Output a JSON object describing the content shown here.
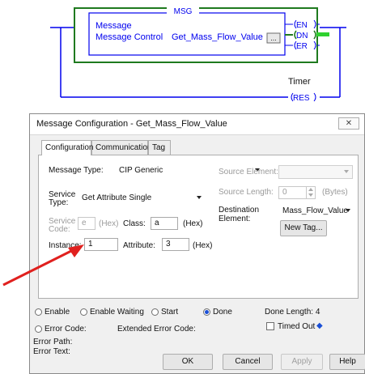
{
  "ladder": {
    "block_title": "MSG",
    "message_label": "Message",
    "control_label": "Message Control",
    "control_value": "Get_Mass_Flow_Value",
    "ellipsis": "...",
    "coils": [
      "EN",
      "DN",
      "ER"
    ],
    "timer_label": "Timer",
    "reset_coil": "RES",
    "colors": {
      "active_rung": "#1f7a1f",
      "dn_highlight": "#2fd12f",
      "rung": "#0000ee"
    }
  },
  "dialog": {
    "title": "Message Configuration - Get_Mass_Flow_Value",
    "close_icon": "close-icon",
    "close_glyph": "✕",
    "tabs": [
      {
        "label": "Configuration",
        "active": true
      },
      {
        "label": "Communication",
        "active": false
      },
      {
        "label": "Tag",
        "active": false
      }
    ],
    "config": {
      "message_type_label": "Message Type:",
      "message_type_value": "CIP Generic",
      "service_type_label_1": "Service",
      "service_type_label_2": "Type:",
      "service_type_value": "Get Attribute Single",
      "service_code_label_1": "Service",
      "service_code_label_2": "Code:",
      "service_code_value": "e",
      "service_code_unit": "(Hex)",
      "class_label": "Class:",
      "class_value": "a",
      "class_unit": "(Hex)",
      "instance_label": "Instance:",
      "instance_value": "1",
      "attribute_label": "Attribute:",
      "attribute_value": "3",
      "attribute_unit": "(Hex)",
      "source_element_label": "Source Element:",
      "source_element_value": "",
      "source_length_label": "Source Length:",
      "source_length_value": "0",
      "source_length_unit": "(Bytes)",
      "destination_label_1": "Destination",
      "destination_label_2": "Element:",
      "destination_value": "Mass_Flow_Value",
      "new_tag_button": "New Tag..."
    },
    "status": {
      "enable": "Enable",
      "enable_waiting": "Enable Waiting",
      "start": "Start",
      "done": "Done",
      "done_length": "Done Length: 4",
      "error_code": "Error Code:",
      "extended_error_code": "Extended Error Code:",
      "timed_out": "Timed Out",
      "timed_out_marker": "◆",
      "error_path": "Error Path:",
      "error_text": "Error Text:"
    },
    "buttons": {
      "ok": "OK",
      "cancel": "Cancel",
      "apply": "Apply",
      "help": "Help"
    }
  },
  "annotation": {
    "arrow_color": "#e0201e"
  }
}
